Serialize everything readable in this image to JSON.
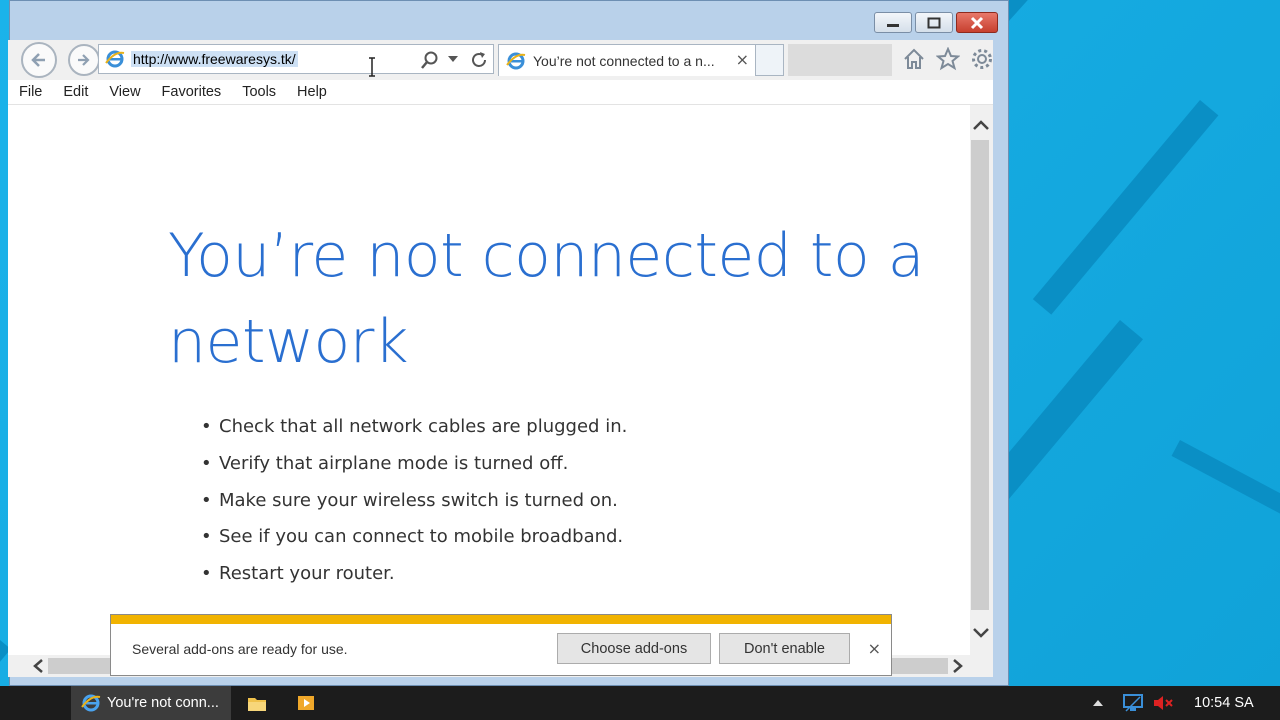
{
  "browser": {
    "url": "http://www.freewaresys.tk/",
    "tab_title": "You’re not connected to a n...",
    "tab_close": "×",
    "menu": [
      "File",
      "Edit",
      "View",
      "Favorites",
      "Tools",
      "Help"
    ]
  },
  "page": {
    "headline": "You’re not connected to a network",
    "bullet": "•",
    "tips": [
      "Check that all network cables are plugged in.",
      "Verify that airplane mode is turned off.",
      "Make sure your wireless switch is turned on.",
      "See if you can connect to mobile broadband.",
      "Restart your router."
    ]
  },
  "notification": {
    "message": "Several add-ons are ready for use.",
    "choose_label": "Choose add-ons",
    "dont_enable_label": "Don't enable",
    "close": "×",
    "accent_color": "#f1b300"
  },
  "taskbar": {
    "active_item_label": "You're not conn...",
    "clock": "10:54 SA",
    "icons": [
      "ie-icon",
      "file-explorer-icon",
      "media-player-icon",
      "show-hidden-icons-icon",
      "network-icon",
      "volume-muted-icon"
    ]
  },
  "colors": {
    "headline": "#2a6fd0",
    "desktop": "#16a8df"
  }
}
